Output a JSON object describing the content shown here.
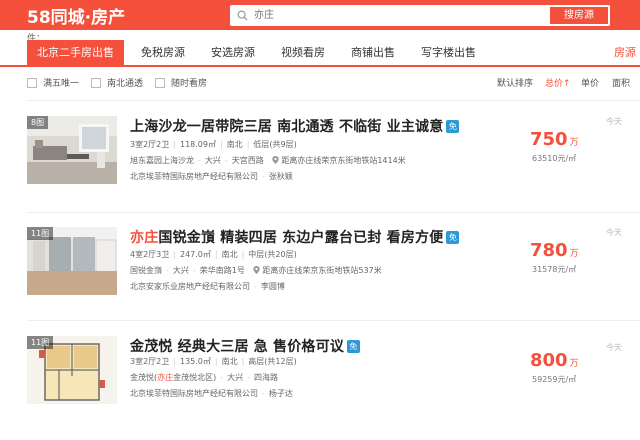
{
  "header": {
    "logo_number": "58",
    "logo_text": "同城·房产",
    "search_placeholder": "亦庄",
    "search_button": "搜房源"
  },
  "city_label": "件：",
  "nav": {
    "tabs": [
      "北京二手房出售",
      "免税房源",
      "安选房源",
      "视频看房",
      "商铺出售",
      "写字楼出售"
    ],
    "right_link": "房源",
    "active_index": 0
  },
  "filters": {
    "checkboxes": [
      "满五唯一",
      "南北通透",
      "随时看房"
    ],
    "sort_options": [
      "默认排序",
      "总价",
      "单价",
      "面积"
    ],
    "sort_active": "总价",
    "sort_arrow": "↑"
  },
  "listings": [
    {
      "photo_count": "8图",
      "title_parts": [
        {
          "text": "上海沙龙一居带院三居 南北通透 不临街 业主诚意",
          "hl": false
        }
      ],
      "badge": "免",
      "specs": [
        "3室2厅2卫",
        "118.09㎡",
        "南北",
        "低层(共9层)"
      ],
      "location": {
        "community": "旭东嘉园上海沙龙",
        "district": "大兴",
        "area": "天宫西路",
        "subway": "距离亦庄线荣京东街地铁站1414米"
      },
      "broker": {
        "company": "北京埃菲特国际房地产经纪有限公司",
        "name": "张秋颖"
      },
      "price": "750",
      "price_unit": "万",
      "unit_price": "63510元/㎡",
      "time": "今天"
    },
    {
      "photo_count": "11图",
      "title_parts": [
        {
          "text": "亦庄",
          "hl": true
        },
        {
          "text": "国锐金嵿 精装四居 东边户露台已封 看房方便",
          "hl": false
        }
      ],
      "badge": "免",
      "specs": [
        "4室2厅3卫",
        "247.0㎡",
        "南北",
        "中层(共20层)"
      ],
      "location": {
        "community": "国锐金嵿",
        "district": "大兴",
        "area": "荣华南路1号",
        "subway": "距离亦庄线荣京东街地铁站537米"
      },
      "broker": {
        "company": "北京安家乐业房地产经纪有限公司",
        "name": "李圆博"
      },
      "price": "780",
      "price_unit": "万",
      "unit_price": "31578元/㎡",
      "time": "今天"
    },
    {
      "photo_count": "11图",
      "title_parts": [
        {
          "text": "金茂悦 经典大三居 急 售价格可议",
          "hl": false
        }
      ],
      "badge": "免",
      "specs": [
        "3室2厅2卫",
        "135.0㎡",
        "南北",
        "高层(共12层)"
      ],
      "location": {
        "community_pre": "金茂悦(",
        "community_hl": "亦庄",
        "community_post": "金茂悦北区)",
        "district": "大兴",
        "area": "四海路"
      },
      "broker": {
        "company": "北京埃菲特国际房地产经纪有限公司",
        "name": "杨子达"
      },
      "price": "800",
      "price_unit": "万",
      "unit_price": "59259元/㎡",
      "time": "今天"
    }
  ],
  "colors": {
    "accent": "#f4503c",
    "badge_blue": "#2d9ad8"
  }
}
